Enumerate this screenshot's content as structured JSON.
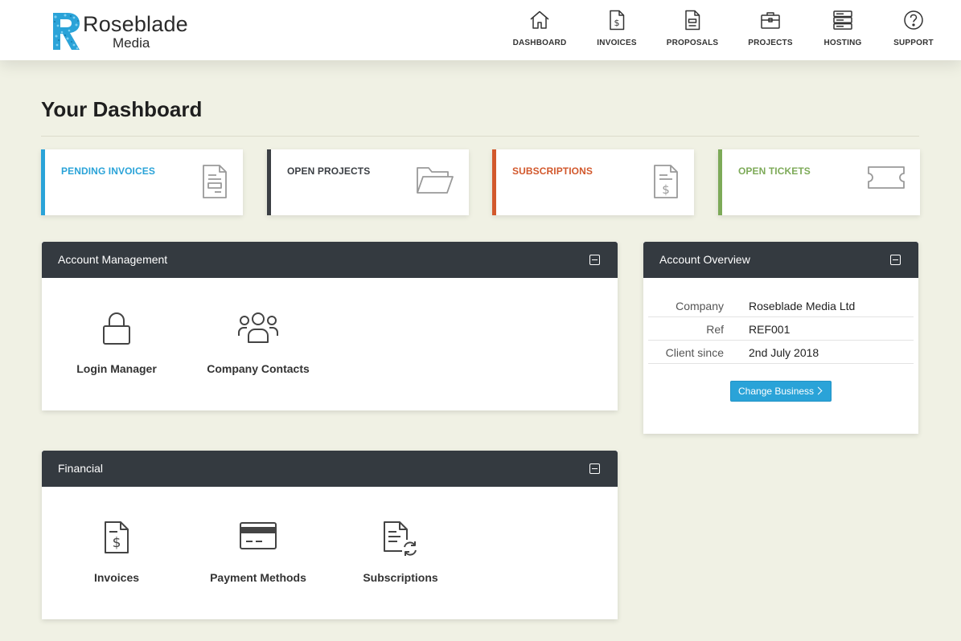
{
  "brand": {
    "logo_letter": "R",
    "name": "Roseblade",
    "sub": "Media"
  },
  "nav": {
    "items": [
      {
        "label": "DASHBOARD",
        "icon": "home-icon"
      },
      {
        "label": "INVOICES",
        "icon": "invoice-icon"
      },
      {
        "label": "PROPOSALS",
        "icon": "proposal-icon"
      },
      {
        "label": "PROJECTS",
        "icon": "briefcase-icon"
      },
      {
        "label": "HOSTING",
        "icon": "server-icon"
      },
      {
        "label": "SUPPORT",
        "icon": "help-circle-icon"
      }
    ]
  },
  "page": {
    "title": "Your Dashboard"
  },
  "stats": [
    {
      "label": "PENDING INVOICES",
      "color": "#2aa3d8",
      "icon": "invoice-document-icon"
    },
    {
      "label": "OPEN PROJECTS",
      "color": "#3b3f44",
      "icon": "folder-open-icon"
    },
    {
      "label": "SUBSCRIPTIONS",
      "color": "#d2582c",
      "icon": "dollar-document-icon"
    },
    {
      "label": "OPEN TICKETS",
      "color": "#7daa58",
      "icon": "ticket-icon"
    }
  ],
  "account_management": {
    "title": "Account Management",
    "tiles": [
      {
        "label": "Login Manager",
        "icon": "lock-icon"
      },
      {
        "label": "Company Contacts",
        "icon": "users-icon"
      }
    ]
  },
  "financial": {
    "title": "Financial",
    "tiles": [
      {
        "label": "Invoices",
        "icon": "invoice-icon"
      },
      {
        "label": "Payment Methods",
        "icon": "credit-card-icon"
      },
      {
        "label": "Subscriptions",
        "icon": "subscription-refresh-icon"
      }
    ]
  },
  "account_overview": {
    "title": "Account Overview",
    "rows": [
      {
        "key": "Company",
        "value": "Roseblade Media Ltd"
      },
      {
        "key": "Ref",
        "value": "REF001"
      },
      {
        "key": "Client since",
        "value": "2nd July 2018"
      }
    ],
    "button_label": "Change Business"
  },
  "colors": {
    "header_bg": "#ffffff",
    "page_bg": "#f0f1e4",
    "panel_head": "#343a40",
    "accent": "#2aa3d8"
  }
}
